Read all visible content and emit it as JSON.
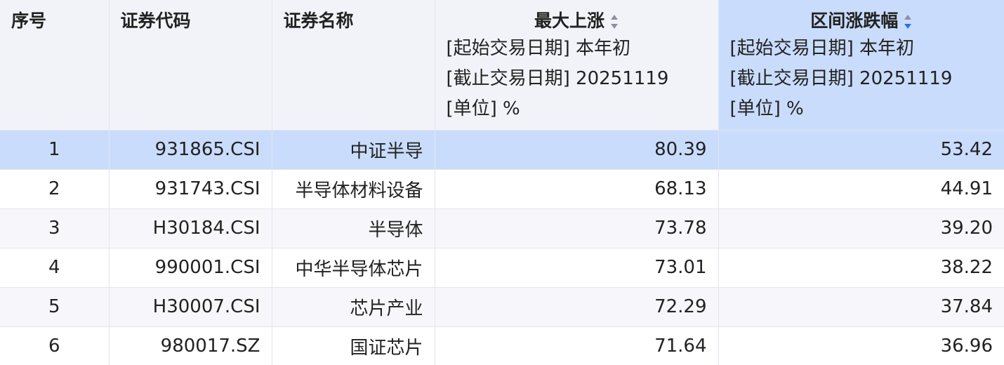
{
  "table": {
    "columns": [
      {
        "key": "index",
        "title": "序号",
        "sortable": false,
        "header_lines": []
      },
      {
        "key": "code",
        "title": "证券代码",
        "sortable": false,
        "header_lines": []
      },
      {
        "key": "name",
        "title": "证券名称",
        "sortable": false,
        "header_lines": []
      },
      {
        "key": "max_rise",
        "title": "最大上涨",
        "sortable": true,
        "sort_state": "none",
        "header_lines": [
          "[起始交易日期] 本年初",
          "[截止交易日期] 20251119",
          "[单位] %"
        ]
      },
      {
        "key": "range_change",
        "title": "区间涨跌幅",
        "sortable": true,
        "sort_state": "descending",
        "header_lines": [
          "[起始交易日期] 本年初",
          "[截止交易日期] 20251119",
          "[单位] %"
        ]
      }
    ],
    "selected_row": 0,
    "selected_column": "range_change",
    "rows": [
      {
        "index": "1",
        "code": "931865.CSI",
        "name": "中证半导",
        "max_rise": "80.39",
        "range_change": "53.42"
      },
      {
        "index": "2",
        "code": "931743.CSI",
        "name": "半导体材料设备",
        "max_rise": "68.13",
        "range_change": "44.91"
      },
      {
        "index": "3",
        "code": "H30184.CSI",
        "name": "半导体",
        "max_rise": "73.78",
        "range_change": "39.20"
      },
      {
        "index": "4",
        "code": "990001.CSI",
        "name": "中华半导体芯片",
        "max_rise": "73.01",
        "range_change": "38.22"
      },
      {
        "index": "5",
        "code": "H30007.CSI",
        "name": "芯片产业",
        "max_rise": "72.29",
        "range_change": "37.84"
      },
      {
        "index": "6",
        "code": "980017.SZ",
        "name": "国证芯片",
        "max_rise": "71.64",
        "range_change": "36.96"
      }
    ]
  },
  "colors": {
    "header_bg": "#f2f3f8",
    "selected_bg": "#c9dcfb",
    "row_alt_bg": "#f7f7fb",
    "sort_inactive": "#8c8fa3",
    "sort_active": "#2f6fe6"
  },
  "icons": {
    "sort": "sort-icon"
  }
}
